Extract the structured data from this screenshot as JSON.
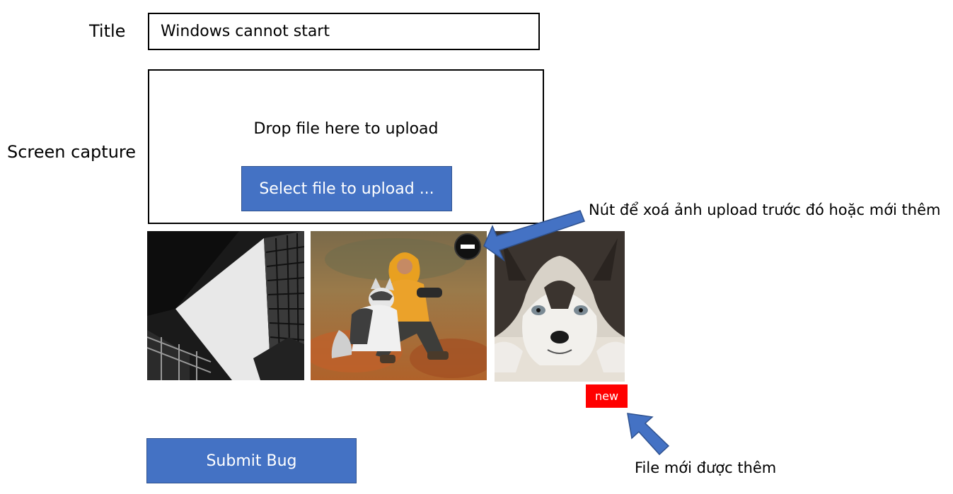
{
  "form": {
    "title_label": "Title",
    "title_value": "Windows cannot start",
    "screen_capture_label": "Screen capture",
    "drop_text": "Drop file here to upload",
    "select_button_label": "Select file to upload ...",
    "submit_button_label": "Submit Bug"
  },
  "thumbnails": [
    {
      "name": "building-photo"
    },
    {
      "name": "boy-with-husky-photo",
      "has_remove_button": true
    },
    {
      "name": "husky-closeup-photo",
      "badge": "new"
    }
  ],
  "annotations": {
    "remove_note": "Nút để xoá ảnh upload trước đó hoặc mới thêm",
    "new_file_note": "File mới được thêm"
  },
  "colors": {
    "button_blue": "#4472c4",
    "badge_red": "#ff0000",
    "arrow_blue": "#4472c4"
  }
}
